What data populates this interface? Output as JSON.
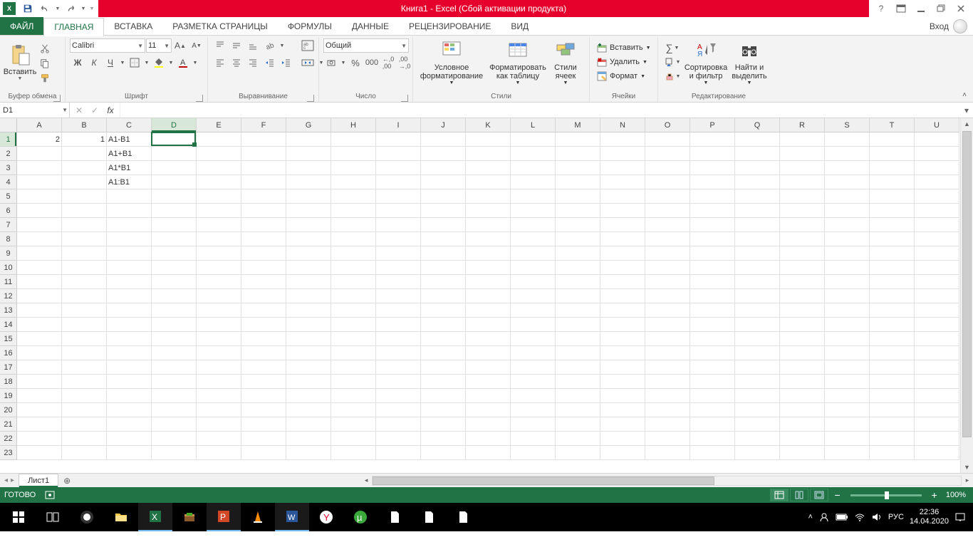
{
  "title": "Книга1 -  Excel (Сбой активации продукта)",
  "tabs": {
    "file": "ФАЙЛ",
    "items": [
      "ГЛАВНАЯ",
      "ВСТАВКА",
      "РАЗМЕТКА СТРАНИЦЫ",
      "ФОРМУЛЫ",
      "ДАННЫЕ",
      "РЕЦЕНЗИРОВАНИЕ",
      "ВИД"
    ],
    "login": "Вход"
  },
  "ribbon": {
    "clipboard": {
      "paste": "Вставить",
      "label": "Буфер обмена"
    },
    "font": {
      "name": "Calibri",
      "size": "11",
      "label": "Шрифт",
      "bold": "Ж",
      "italic": "К",
      "underline": "Ч"
    },
    "align": {
      "label": "Выравнивание"
    },
    "number": {
      "format": "Общий",
      "label": "Число"
    },
    "styles": {
      "cond": "Условное\nформатирование",
      "table": "Форматировать\nкак таблицу",
      "cell": "Стили\nячеек",
      "label": "Стили"
    },
    "cells": {
      "insert": "Вставить",
      "delete": "Удалить",
      "format": "Формат",
      "label": "Ячейки"
    },
    "editing": {
      "sort": "Сортировка\nи фильтр",
      "find": "Найти и\nвыделить",
      "label": "Редактирование"
    }
  },
  "namebox": "D1",
  "formula": "",
  "columns": [
    "A",
    "B",
    "C",
    "D",
    "E",
    "F",
    "G",
    "H",
    "I",
    "J",
    "K",
    "L",
    "M",
    "N",
    "O",
    "P",
    "Q",
    "R",
    "S",
    "T",
    "U"
  ],
  "rows": 23,
  "active": {
    "col": 3,
    "row": 0
  },
  "data": {
    "A1": "2",
    "B1": "1",
    "C1": "A1-B1",
    "C2": "A1+B1",
    "C3": "A1*B1",
    "C4": "A1:B1"
  },
  "sheet": {
    "name": "Лист1"
  },
  "status": {
    "ready": "ГОТОВО",
    "zoom": "100%"
  },
  "tray": {
    "lang": "РУС",
    "time": "22:36",
    "date": "14.04.2020"
  }
}
